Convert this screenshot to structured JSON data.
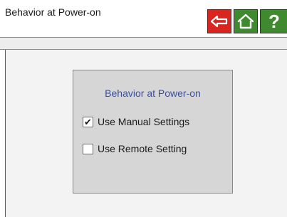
{
  "window": {
    "title": "Behavior at Power-on"
  },
  "toolbar": {
    "back_icon": "back-arrow-icon",
    "home_icon": "home-icon",
    "help_label": "?",
    "colors": {
      "back": "#d9241f",
      "home": "#3f8a2e",
      "help": "#3f8a2e"
    }
  },
  "panel": {
    "title": "Behavior at Power-on",
    "options": [
      {
        "label": "Use Manual Settings",
        "checked": true,
        "check_glyph": "✔"
      },
      {
        "label": "Use Remote Setting",
        "checked": false,
        "check_glyph": ""
      }
    ]
  }
}
